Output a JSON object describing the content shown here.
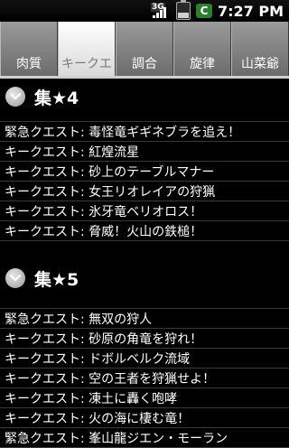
{
  "status": {
    "network": "3G",
    "time": "7:27 PM",
    "battery_level": 0.35
  },
  "tabs": [
    {
      "label": "肉質",
      "selected": false
    },
    {
      "label": "キークエ",
      "selected": true
    },
    {
      "label": "調合",
      "selected": false
    },
    {
      "label": "旋律",
      "selected": false
    },
    {
      "label": "山菜爺",
      "selected": false
    }
  ],
  "groups": [
    {
      "title": "集★4",
      "items": [
        "緊急クエスト: 毒怪竜ギギネブラを追え！",
        "キークエスト: 紅煌流星",
        "キークエスト: 砂上のテーブルマナー",
        "キークエスト: 女王リオレイアの狩猟",
        "キークエスト: 氷牙竜ベリオロス！",
        "キークエスト: 脅威！火山の鉄槌！"
      ]
    },
    {
      "title": "集★5",
      "items": [
        "緊急クエスト: 無双の狩人",
        "キークエスト: 砂原の角竜を狩れ！",
        "キークエスト: ドボルベルク流域",
        "キークエスト: 空の王者を狩猟せよ！",
        "キークエスト: 凍土に轟く咆哮",
        "キークエスト: 火の海に棲む竜！",
        "緊急クエスト: 峯山龍ジエン・モーラン"
      ]
    }
  ]
}
